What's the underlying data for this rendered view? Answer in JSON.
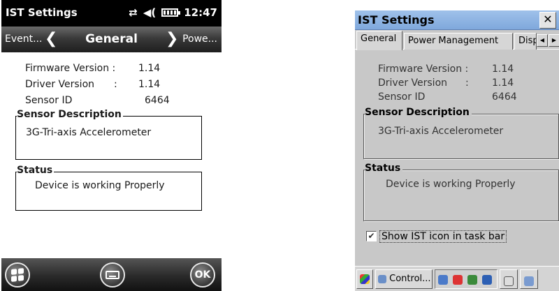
{
  "handheld": {
    "title": "IST Settings",
    "status_glyphs": [
      "⇄",
      "◀("
    ],
    "time": "12:47",
    "nav": {
      "prev": "Event...",
      "current": "General",
      "next": "Powe..."
    },
    "info": {
      "firmware_label": "Firmware Version :",
      "firmware_value": "1.14",
      "driver_label": "Driver Version",
      "driver_sep": ":",
      "driver_value": "1.14",
      "sensor_label": "Sensor ID",
      "sensor_value": "6464"
    },
    "sensor_description": {
      "title": "Sensor Description",
      "text": "3G-Tri-axis Accelerometer"
    },
    "status": {
      "title": "Status",
      "text": "Device is working Properly"
    },
    "bottom_bar": {
      "ok_label": "OK"
    }
  },
  "ce": {
    "title": "IST Settings",
    "close_glyph": "✕",
    "tabs": [
      "General",
      "Power Management",
      "Disp"
    ],
    "active_tab": "General",
    "info": {
      "firmware_label": "Firmware Version :",
      "firmware_value": "1.14",
      "driver_label": "Driver Version",
      "driver_sep": ":",
      "driver_value": "1.14",
      "sensor_label": "Sensor ID",
      "sensor_value": "6464"
    },
    "sensor_description": {
      "title": "Sensor Description",
      "text": "3G-Tri-axis Accelerometer"
    },
    "status": {
      "title": "Status",
      "text": "Device is working Properly"
    },
    "checkbox": {
      "label": "Show IST icon in task bar",
      "checked": true,
      "mark": "✔"
    },
    "taskbar": {
      "task_label": "Control..."
    }
  },
  "colors": {
    "ce_title_bg": "#9fc1ea",
    "ce_face": "#c8c8c8",
    "handheld_bar": "#000000"
  }
}
